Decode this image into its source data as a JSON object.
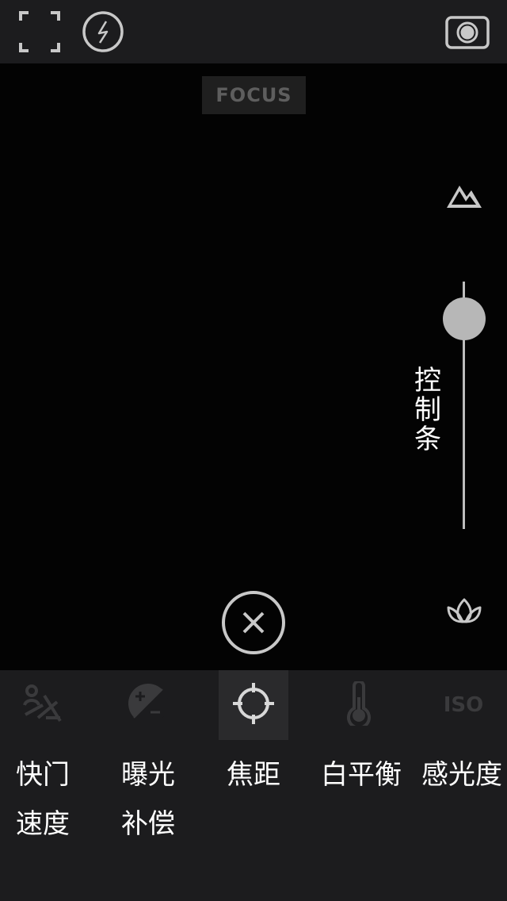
{
  "topbar": {
    "fullscreen_icon": "fullscreen-corners-icon",
    "flash_icon": "flash-off-icon",
    "camera_icon": "camera-capture-icon"
  },
  "viewfinder": {
    "focus_label": "FOCUS"
  },
  "slider": {
    "top_icon": "mountain-icon",
    "bottom_icon": "leaf-icon",
    "caption": "控\n制\n条",
    "level": 0.85
  },
  "close_icon": "close-circle-icon",
  "tools": [
    {
      "icon": "shutter-speed-icon",
      "label": "快门\n速度",
      "active": false
    },
    {
      "icon": "exposure-compensation-icon",
      "label": "曝光\n补偿",
      "active": false
    },
    {
      "icon": "focus-crosshair-icon",
      "label": "焦距",
      "active": true
    },
    {
      "icon": "thermometer-icon",
      "label": "白平衡",
      "active": false
    },
    {
      "icon": "iso-icon",
      "icon_text": "ISO",
      "label": "感光度",
      "active": false
    }
  ],
  "colors": {
    "bar_background": "#1c1c1e",
    "active_tool": "#2a2a2c",
    "icon_dim": "#3a3a3c",
    "icon_light": "#c8c8c8"
  }
}
